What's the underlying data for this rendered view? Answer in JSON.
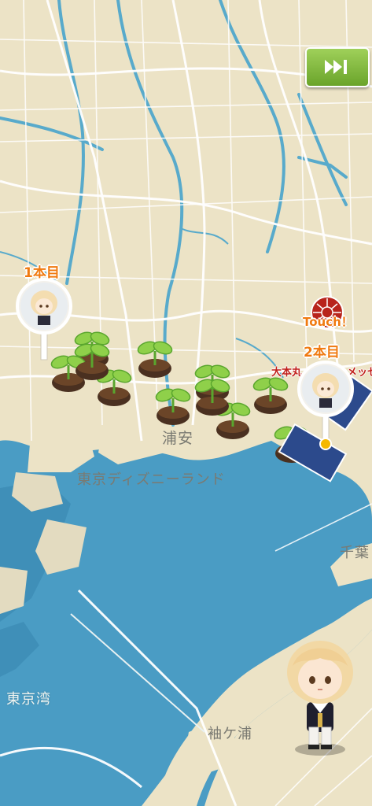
{
  "map": {
    "places": {
      "urayasu": "浦安",
      "disney": "東京ディズニーランド",
      "chiba": "千葉",
      "tokyo_bay": "東京湾",
      "sodegaura": "袖ケ浦"
    },
    "colors": {
      "land": "#ece3c6",
      "water": "#4a9cc4",
      "rivers": "#58aacb",
      "roads": "#ffffff",
      "label_orange": "#f07a10",
      "skip_green": "#7ab83a"
    }
  },
  "pins": [
    {
      "label": "1本目",
      "icon": "character-portrait-pin-icon"
    },
    {
      "label": "2本目",
      "icon": "character-portrait-pin-icon"
    }
  ],
  "landmark": {
    "touch_label": "Touch！",
    "name": "大本丸",
    "suffix": "メッセ",
    "icon": "shrine-emblem-icon"
  },
  "skip_button": {
    "icon": "fast-forward-icon"
  },
  "sprouts_count": 11,
  "character": {
    "icon": "chibi-character-icon"
  }
}
